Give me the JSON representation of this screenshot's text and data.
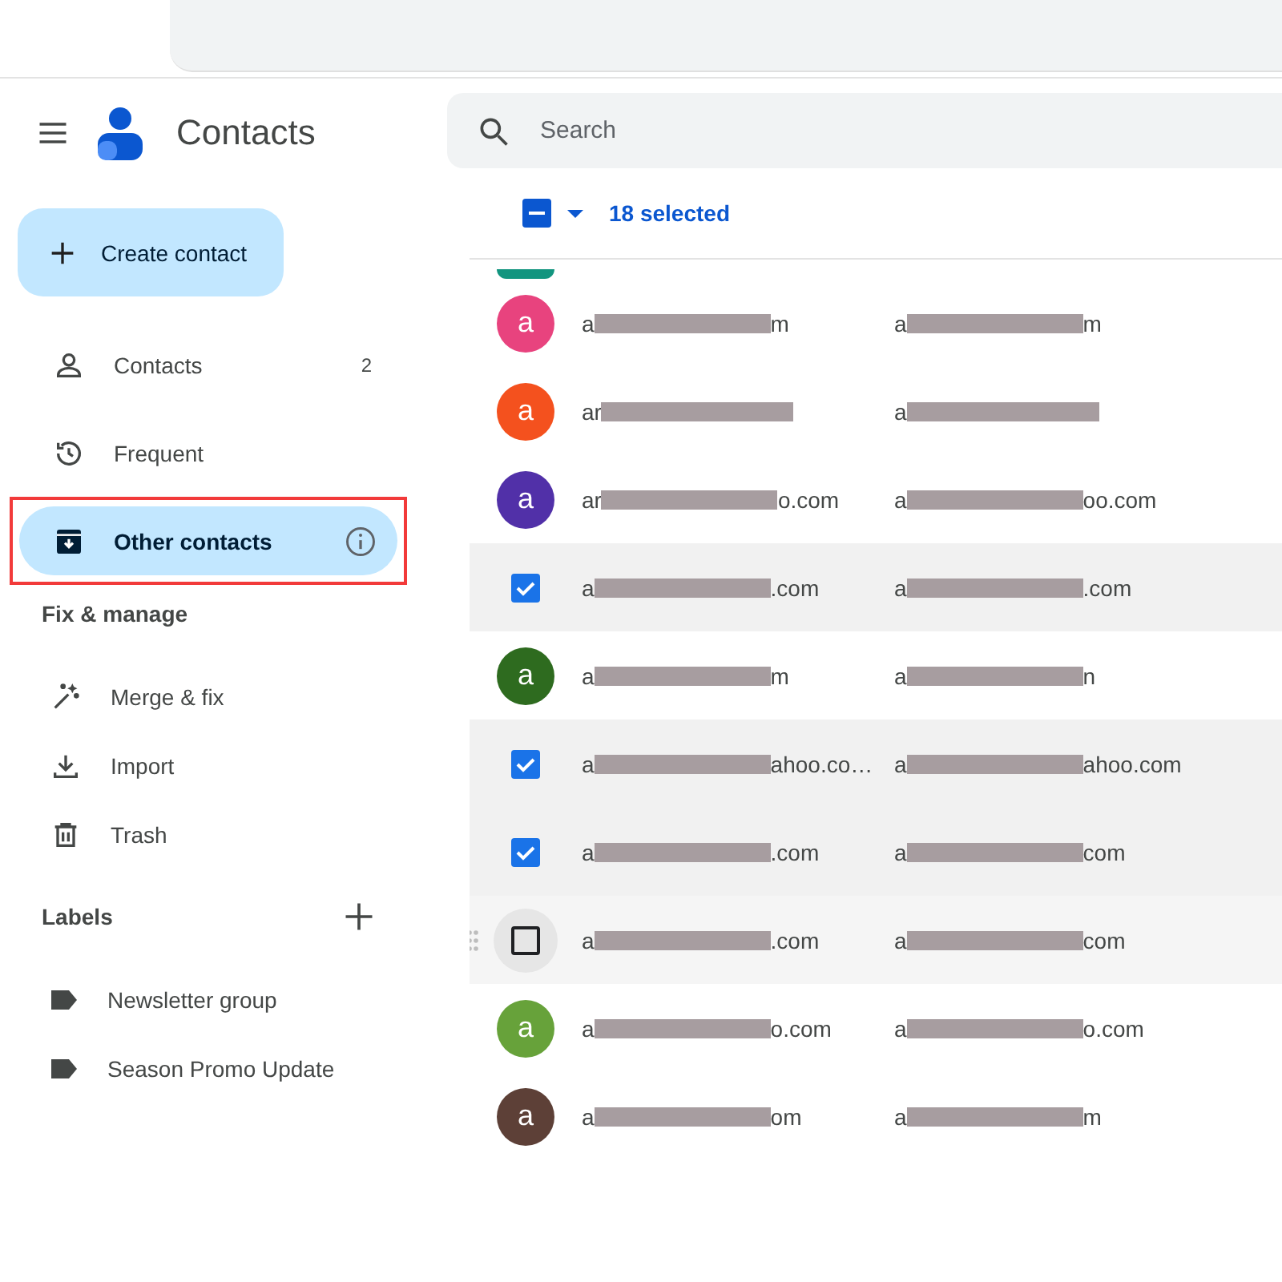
{
  "app": {
    "title": "Contacts"
  },
  "search": {
    "placeholder": "Search"
  },
  "create_button": {
    "label": "Create contact"
  },
  "nav": [
    {
      "kind": "person",
      "label": "Contacts",
      "count": "2",
      "selected": false,
      "annotated": false
    },
    {
      "kind": "history",
      "label": "Frequent",
      "selected": false,
      "annotated": false
    },
    {
      "kind": "archive",
      "label": "Other contacts",
      "selected": true,
      "annotated": true,
      "info": true
    }
  ],
  "fix_manage": {
    "heading": "Fix & manage",
    "items": [
      {
        "kind": "wand",
        "label": "Merge & fix"
      },
      {
        "kind": "download",
        "label": "Import"
      },
      {
        "kind": "trash",
        "label": "Trash"
      }
    ]
  },
  "labels": {
    "heading": "Labels",
    "items": [
      {
        "label": "Newsletter group"
      },
      {
        "label": "Season Promo Update"
      }
    ]
  },
  "selection": {
    "label": "18 selected"
  },
  "rows": [
    {
      "kind": "avatar",
      "color": "#12957f",
      "peek": true
    },
    {
      "kind": "avatar",
      "letter": "a",
      "color": "#e8437e",
      "email": {
        "start": "a",
        "end": "m"
      },
      "phone": {
        "start": "a",
        "end": "m"
      }
    },
    {
      "kind": "avatar",
      "letter": "a",
      "color": "#f4511e",
      "email": {
        "start": "ar"
      },
      "phone": {
        "start": "a"
      }
    },
    {
      "kind": "avatar",
      "letter": "a",
      "color": "#5130a8",
      "email": {
        "start": "ar",
        "end": "o.com"
      },
      "phone": {
        "start": "a",
        "end": "oo.com"
      }
    },
    {
      "kind": "checkbox",
      "checked": true,
      "email": {
        "start": "a",
        "end": ".com"
      },
      "phone": {
        "start": "a",
        "end": ".com"
      }
    },
    {
      "kind": "avatar",
      "letter": "a",
      "color": "#2e6b1f",
      "email": {
        "start": "a",
        "end": "m"
      },
      "phone": {
        "start": "a",
        "end": "n"
      }
    },
    {
      "kind": "checkbox",
      "checked": true,
      "email": {
        "start": "a",
        "end": "ahoo.co…"
      },
      "phone": {
        "start": "a",
        "end": "ahoo.com"
      }
    },
    {
      "kind": "checkbox",
      "checked": true,
      "email": {
        "start": "a",
        "end": ".com"
      },
      "phone": {
        "start": "a",
        "end": "com"
      }
    },
    {
      "kind": "checkbox",
      "checked": false,
      "hovered": true,
      "email": {
        "start": "a",
        "end": ".com"
      },
      "phone": {
        "start": "a",
        "end": "com"
      }
    },
    {
      "kind": "avatar",
      "letter": "a",
      "color": "#67a23a",
      "email": {
        "start": "a",
        "end": "o.com"
      },
      "phone": {
        "start": "a",
        "end": "o.com"
      }
    },
    {
      "kind": "avatar",
      "letter": "a",
      "color": "#5d4037",
      "email": {
        "start": "a",
        "end": "om"
      },
      "phone": {
        "start": "a",
        "end": "m"
      }
    }
  ]
}
